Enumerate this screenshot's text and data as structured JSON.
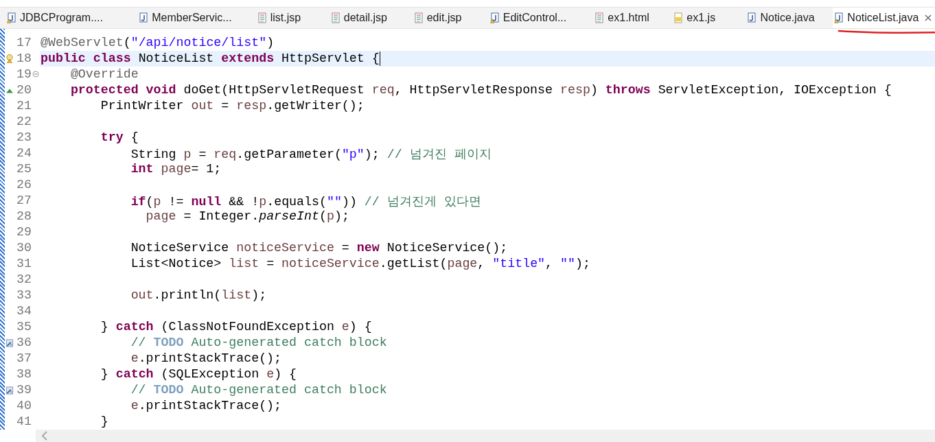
{
  "tabs": [
    {
      "label": "JDBCProgram....",
      "kind": "java-warning",
      "selected": false
    },
    {
      "label": "MemberServic...",
      "kind": "java",
      "selected": false
    },
    {
      "label": "list.jsp",
      "kind": "jsp",
      "selected": false
    },
    {
      "label": "detail.jsp",
      "kind": "jsp",
      "selected": false
    },
    {
      "label": "edit.jsp",
      "kind": "jsp",
      "selected": false
    },
    {
      "label": "EditControl...",
      "kind": "java-warning",
      "selected": false
    },
    {
      "label": "ex1.html",
      "kind": "html",
      "selected": false
    },
    {
      "label": "ex1.js",
      "kind": "js",
      "selected": false
    },
    {
      "label": "Notice.java",
      "kind": "java",
      "selected": false
    },
    {
      "label": "NoticeList.java",
      "kind": "java-warning",
      "selected": true
    }
  ],
  "editor": {
    "lines": [
      {
        "number": "17",
        "tokens": [
          {
            "t": "@WebServlet",
            "kind": "annotation"
          },
          {
            "t": "(",
            "kind": "plain"
          },
          {
            "t": "\"/api/notice/list\"",
            "kind": "string"
          },
          {
            "t": ")",
            "kind": "plain"
          }
        ]
      },
      {
        "number": "18",
        "kind": "warning",
        "current": true,
        "tokens": [
          {
            "t": "public ",
            "kind": "keyword"
          },
          {
            "t": "class",
            "kind": "keyword"
          },
          {
            "t": " NoticeList ",
            "kind": "plain"
          },
          {
            "t": "extends",
            "kind": "keyword"
          },
          {
            "t": " HttpServlet {",
            "kind": "plain"
          }
        ]
      },
      {
        "number": "19",
        "kind": "fold",
        "tokens": [
          {
            "t": "    @Override",
            "kind": "annotation"
          }
        ]
      },
      {
        "number": "20",
        "kind": "override",
        "tokens": [
          {
            "t": "    protected void",
            "kind": "keyword"
          },
          {
            "t": " doGet(HttpServletRequest ",
            "kind": "plain"
          },
          {
            "t": "req",
            "kind": "variable"
          },
          {
            "t": ", HttpServletResponse ",
            "kind": "plain"
          },
          {
            "t": "resp",
            "kind": "variable"
          },
          {
            "t": ") ",
            "kind": "plain"
          },
          {
            "t": "throws",
            "kind": "keyword"
          },
          {
            "t": " ServletException, IOException {",
            "kind": "plain"
          }
        ]
      },
      {
        "number": "21",
        "tokens": [
          {
            "t": "        PrintWriter ",
            "kind": "plain"
          },
          {
            "t": "out",
            "kind": "variable"
          },
          {
            "t": " = ",
            "kind": "plain"
          },
          {
            "t": "resp",
            "kind": "variable"
          },
          {
            "t": ".getWriter();",
            "kind": "plain"
          }
        ]
      },
      {
        "number": "22"
      },
      {
        "number": "23",
        "tokens": [
          {
            "t": "        try",
            "kind": "keyword"
          },
          {
            "t": " {",
            "kind": "plain"
          }
        ]
      },
      {
        "number": "24",
        "tokens": [
          {
            "t": "            String ",
            "kind": "plain"
          },
          {
            "t": "p",
            "kind": "variable"
          },
          {
            "t": " = ",
            "kind": "plain"
          },
          {
            "t": "req",
            "kind": "variable"
          },
          {
            "t": ".getParameter(",
            "kind": "plain"
          },
          {
            "t": "\"p\"",
            "kind": "string"
          },
          {
            "t": "); ",
            "kind": "plain"
          },
          {
            "t": "// 넘겨진 페이지",
            "kind": "comment"
          }
        ]
      },
      {
        "number": "25",
        "tokens": [
          {
            "t": "            int ",
            "kind": "keyword"
          },
          {
            "t": "page",
            "kind": "variable"
          },
          {
            "t": "= 1;",
            "kind": "plain"
          }
        ]
      },
      {
        "number": "26"
      },
      {
        "number": "27",
        "tokens": [
          {
            "t": "            if",
            "kind": "keyword"
          },
          {
            "t": "(",
            "kind": "plain"
          },
          {
            "t": "p",
            "kind": "variable"
          },
          {
            "t": " != ",
            "kind": "plain"
          },
          {
            "t": "null",
            "kind": "keyword"
          },
          {
            "t": " && !",
            "kind": "plain"
          },
          {
            "t": "p",
            "kind": "variable"
          },
          {
            "t": ".equals(",
            "kind": "plain"
          },
          {
            "t": "\"\"",
            "kind": "string"
          },
          {
            "t": ")) ",
            "kind": "plain"
          },
          {
            "t": "// 넘겨진게 있다면",
            "kind": "comment"
          }
        ]
      },
      {
        "number": "28",
        "tokens": [
          {
            "t": "              page",
            "kind": "variable"
          },
          {
            "t": " = Integer.",
            "kind": "plain"
          },
          {
            "t": "parseInt",
            "kind": "static"
          },
          {
            "t": "(",
            "kind": "plain"
          },
          {
            "t": "p",
            "kind": "variable"
          },
          {
            "t": ");",
            "kind": "plain"
          }
        ]
      },
      {
        "number": "29"
      },
      {
        "number": "30",
        "tokens": [
          {
            "t": "            NoticeService ",
            "kind": "plain"
          },
          {
            "t": "noticeService",
            "kind": "variable"
          },
          {
            "t": " = ",
            "kind": "plain"
          },
          {
            "t": "new",
            "kind": "keyword"
          },
          {
            "t": " NoticeService();",
            "kind": "plain"
          }
        ]
      },
      {
        "number": "31",
        "tokens": [
          {
            "t": "            List<Notice> ",
            "kind": "plain"
          },
          {
            "t": "list",
            "kind": "variable"
          },
          {
            "t": " = ",
            "kind": "plain"
          },
          {
            "t": "noticeService",
            "kind": "variable"
          },
          {
            "t": ".getList(",
            "kind": "plain"
          },
          {
            "t": "page",
            "kind": "variable"
          },
          {
            "t": ", ",
            "kind": "plain"
          },
          {
            "t": "\"title\"",
            "kind": "string"
          },
          {
            "t": ", ",
            "kind": "plain"
          },
          {
            "t": "\"\"",
            "kind": "string"
          },
          {
            "t": ");",
            "kind": "plain"
          }
        ]
      },
      {
        "number": "32"
      },
      {
        "number": "33",
        "tokens": [
          {
            "t": "            out",
            "kind": "variable"
          },
          {
            "t": ".println(",
            "kind": "plain"
          },
          {
            "t": "list",
            "kind": "variable"
          },
          {
            "t": ");",
            "kind": "plain"
          }
        ]
      },
      {
        "number": "34"
      },
      {
        "number": "35",
        "tokens": [
          {
            "t": "        } ",
            "kind": "plain"
          },
          {
            "t": "catch",
            "kind": "keyword"
          },
          {
            "t": " (ClassNotFoundException ",
            "kind": "plain"
          },
          {
            "t": "e",
            "kind": "variable"
          },
          {
            "t": ") {",
            "kind": "plain"
          }
        ]
      },
      {
        "number": "36",
        "kind": "task",
        "tokens": [
          {
            "t": "            // ",
            "kind": "comment"
          },
          {
            "t": "TODO",
            "kind": "todo"
          },
          {
            "t": " Auto-generated catch block",
            "kind": "comment"
          }
        ]
      },
      {
        "number": "37",
        "tokens": [
          {
            "t": "            e",
            "kind": "variable"
          },
          {
            "t": ".printStackTrace();",
            "kind": "plain"
          }
        ]
      },
      {
        "number": "38",
        "tokens": [
          {
            "t": "        } ",
            "kind": "plain"
          },
          {
            "t": "catch",
            "kind": "keyword"
          },
          {
            "t": " (SQLException ",
            "kind": "plain"
          },
          {
            "t": "e",
            "kind": "variable"
          },
          {
            "t": ") {",
            "kind": "plain"
          }
        ]
      },
      {
        "number": "39",
        "kind": "task",
        "tokens": [
          {
            "t": "            // ",
            "kind": "comment"
          },
          {
            "t": "TODO",
            "kind": "todo"
          },
          {
            "t": " Auto-generated catch block",
            "kind": "comment"
          }
        ]
      },
      {
        "number": "40",
        "tokens": [
          {
            "t": "            e",
            "kind": "variable"
          },
          {
            "t": ".printStackTrace();",
            "kind": "plain"
          }
        ]
      },
      {
        "number": "41",
        "tokens": [
          {
            "t": "        }",
            "kind": "plain"
          }
        ]
      }
    ]
  }
}
